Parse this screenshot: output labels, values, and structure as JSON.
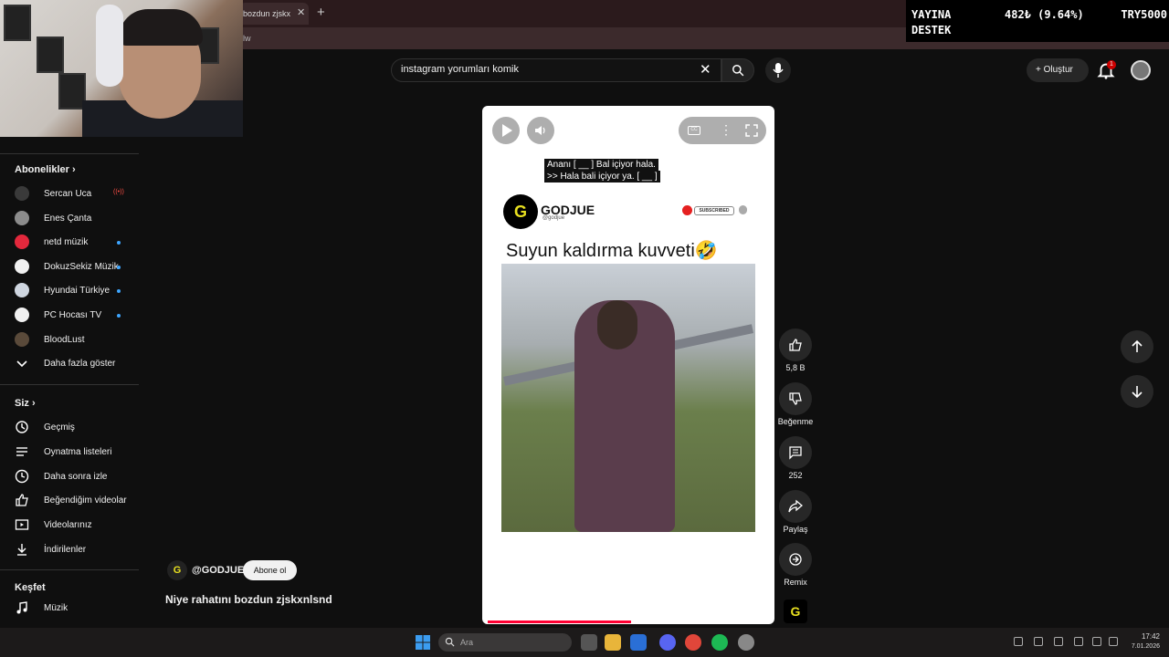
{
  "browser": {
    "tab_title": "bozdun zjskx",
    "tab_close": "✕",
    "new_tab": "+",
    "url_fragment": "lw"
  },
  "donation": {
    "line1": "YAYINA",
    "line2": "DESTEK",
    "amount": "482₺ (9.64%)",
    "goal": "TRY5000"
  },
  "header": {
    "search_value": "instagram yorumları komik",
    "create_label": "Oluştur",
    "notification_count": "1"
  },
  "sidebar": {
    "subscriptions_title": "Abonelikler",
    "subscriptions": [
      {
        "label": "Sercan Uca",
        "color": "#3a3a3a",
        "live": "((•))"
      },
      {
        "label": "Enes Çanta",
        "color": "#8c8c8c"
      },
      {
        "label": "netd müzik",
        "color": "#e3283c",
        "dot": true
      },
      {
        "label": "DokuzSekiz Müzik",
        "color": "#f1f1f1",
        "dot": true
      },
      {
        "label": "Hyundai Türkiye",
        "color": "#cfd6e0",
        "dot": true
      },
      {
        "label": "PC Hocası TV",
        "color": "#f1f1f1",
        "dot": true
      },
      {
        "label": "BloodLust",
        "color": "#5a4a3a"
      }
    ],
    "show_more": "Daha fazla göster",
    "you_title": "Siz",
    "you_items": [
      {
        "label": "Geçmiş",
        "icon": "history-icon"
      },
      {
        "label": "Oynatma listeleri",
        "icon": "playlist-icon"
      },
      {
        "label": "Daha sonra izle",
        "icon": "clock-icon"
      },
      {
        "label": "Beğendiğim videolar",
        "icon": "like-icon"
      },
      {
        "label": "Videolarınız",
        "icon": "video-icon"
      },
      {
        "label": "İndirilenler",
        "icon": "download-icon"
      }
    ],
    "explore_title": "Keşfet",
    "explore_items": [
      {
        "label": "Müzik",
        "icon": "music-icon"
      }
    ]
  },
  "short": {
    "caption_line1": "Ananı [ __ ] Bal içiyor hala.",
    "caption_line2": ">> Hala bali içiyor ya. [ __ ]",
    "brand_name": "GODJUE",
    "brand_handle": "@godjue",
    "brand_logo": "G",
    "subscribed_badge": "SUBSCRIBED",
    "title": "Suyun kaldırma kuvveti🤣",
    "progress": 0.49
  },
  "actions": {
    "like_count": "5,8 B",
    "dislike_label": "Beğenme",
    "comment_count": "252",
    "share_label": "Paylaş",
    "remix_label": "Remix"
  },
  "channel": {
    "handle": "@GODJUE",
    "subscribe_label": "Abone ol",
    "video_title": "Niye rahatını bozdun zjskxnlsnd"
  },
  "taskbar": {
    "search_placeholder": "Ara",
    "time": "17:42",
    "date": "7.01.2026"
  }
}
